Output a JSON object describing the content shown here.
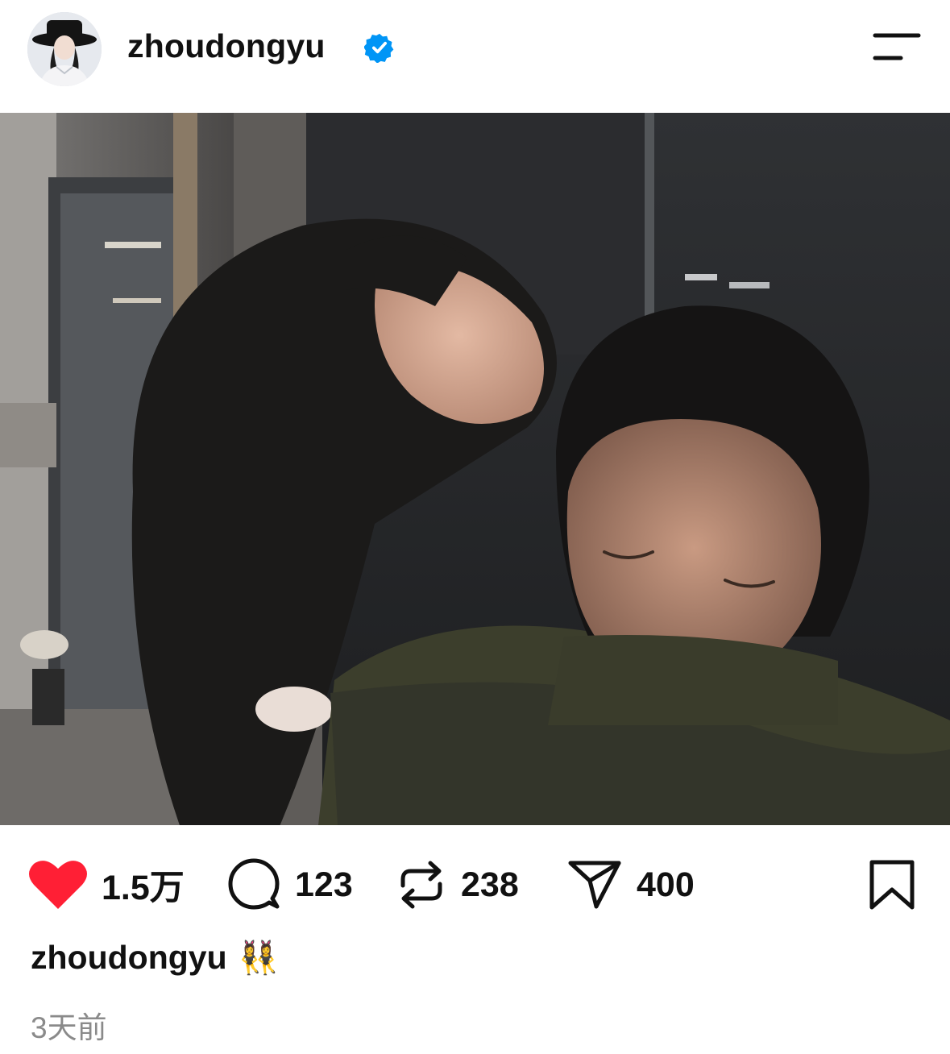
{
  "post": {
    "username": "zhoudongyu",
    "verified": true,
    "icons": {
      "avatar": "profile-avatar-woman-black-hat",
      "verified": "verified-badge-icon",
      "menu": "menu-icon"
    }
  },
  "actions": {
    "like": {
      "icon": "heart-icon",
      "count": "1.5万",
      "liked": true,
      "color": "#ff1f35"
    },
    "comment": {
      "icon": "comment-icon",
      "count": "123"
    },
    "repost": {
      "icon": "repost-icon",
      "count": "238"
    },
    "share": {
      "icon": "send-icon",
      "count": "400"
    },
    "bookmark": {
      "icon": "bookmark-icon"
    }
  },
  "caption": {
    "username": "zhoudongyu",
    "emoji": "👯‍♀️"
  },
  "timestamp": "3天前",
  "watermark": "",
  "colors": {
    "verified_blue": "#0095f6",
    "text": "#111111",
    "muted": "#8a8a8a"
  }
}
